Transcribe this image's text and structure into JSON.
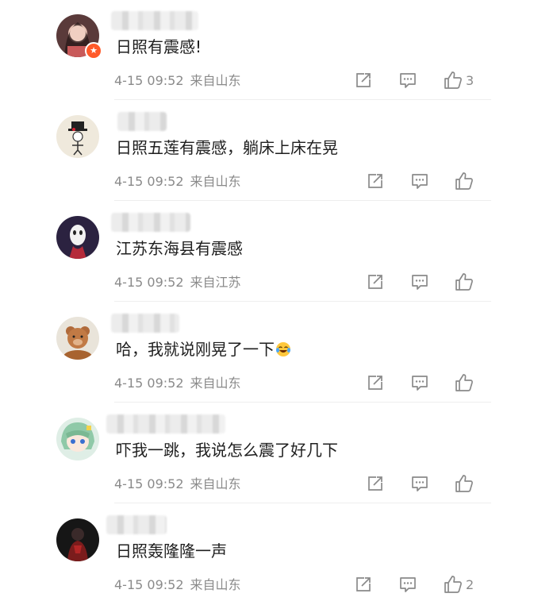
{
  "comments": [
    {
      "text": "日照有震感!",
      "date": "4-15 09:52",
      "location": "来自山东",
      "likes": "3",
      "avatar": "girl-avatar",
      "badge": true
    },
    {
      "text": "日照五莲有震感，躺床上床在晃",
      "date": "4-15 09:52",
      "location": "来自山东",
      "likes": "",
      "avatar": "sketch-figure-avatar",
      "badge": false
    },
    {
      "text": "江苏东海县有震感",
      "date": "4-15 09:52",
      "location": "来自江苏",
      "likes": "",
      "avatar": "masked-figure-avatar",
      "badge": false
    },
    {
      "text": "哈，我就说刚晃了一下",
      "date": "4-15 09:52",
      "location": "来自山东",
      "likes": "",
      "avatar": "teddy-bear-avatar",
      "badge": false,
      "emoji": "crying-laughing-emoji"
    },
    {
      "text": "吓我一跳，我说怎么震了好几下",
      "date": "4-15 09:52",
      "location": "来自山东",
      "likes": "",
      "avatar": "anime-character-avatar",
      "badge": false
    },
    {
      "text": "日照轰隆隆一声",
      "date": "4-15 09:52",
      "location": "来自山东",
      "likes": "2",
      "avatar": "dark-figure-avatar",
      "badge": false
    }
  ],
  "badge_glyph": "★",
  "colors": {
    "meta": "#8a8a8a",
    "badge": "#ff5a2a",
    "text": "#1f1f1f"
  }
}
